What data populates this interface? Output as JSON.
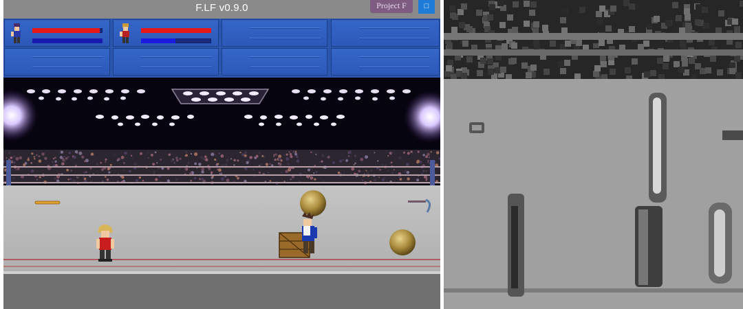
{
  "app": {
    "title": "F.LF v0.9.0",
    "project_button": "Project F",
    "square_button_icon": "square-icon"
  },
  "hud": {
    "players": [
      {
        "hp": 0.96,
        "mp": 1.0,
        "hp_color": "#e81818",
        "mp_color": "#1a1ab0",
        "avatar_icon": "blue-hero-avatar-icon"
      },
      {
        "hp": 1.0,
        "mp": 0.49,
        "hp_color": "#e81818",
        "mp_color": "#1a1ae0",
        "avatar_icon": "red-hero-avatar-icon"
      }
    ],
    "empty_slots": 6
  },
  "scene": {
    "arena": "wrestling ring",
    "items": [
      "baseball-bat",
      "boomerang-hook",
      "stone-ball",
      "stone-ball",
      "wooden-crate"
    ],
    "characters": [
      "red-fighter",
      "blue-fighter"
    ]
  },
  "colors": {
    "hud_blue": "#2f5fbf",
    "titlebar_gray": "#8a8a8a",
    "floor_gray": "#b4b4b4",
    "rope_red": "#b53a3a"
  }
}
